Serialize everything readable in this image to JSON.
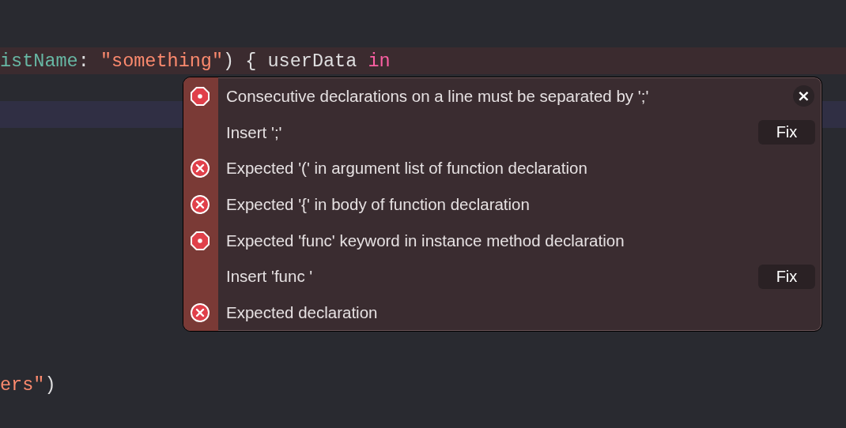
{
  "code_lines": [
    {
      "error": true,
      "current": false,
      "tokens": [
        {
          "text": "istName",
          "kind": "param"
        },
        {
          "text": ": ",
          "kind": "plain"
        },
        {
          "text": "\"something\"",
          "kind": "string"
        },
        {
          "text": ") { userData ",
          "kind": "plain"
        },
        {
          "text": "in",
          "kind": "keyword"
        }
      ]
    },
    {
      "error": false,
      "current": true
    },
    {
      "error": false,
      "current": false,
      "tokens": [
        {
          "text": "ers\"",
          "kind": "string"
        },
        {
          "text": ")",
          "kind": "plain"
        }
      ]
    }
  ],
  "issues": [
    {
      "kind": "fixit_error",
      "message": "Consecutive declarations on a line must be separated by ';'",
      "close": "×"
    },
    {
      "kind": "fix",
      "message": "Insert ';'",
      "action": "Fix"
    },
    {
      "kind": "error",
      "message": "Expected '(' in argument list of function declaration"
    },
    {
      "kind": "error",
      "message": "Expected '{' in body of function declaration"
    },
    {
      "kind": "fixit_error",
      "message": "Expected 'func' keyword in instance method declaration"
    },
    {
      "kind": "fix",
      "message": "Insert 'func '",
      "action": "Fix"
    },
    {
      "kind": "error",
      "message": "Expected declaration"
    }
  ]
}
